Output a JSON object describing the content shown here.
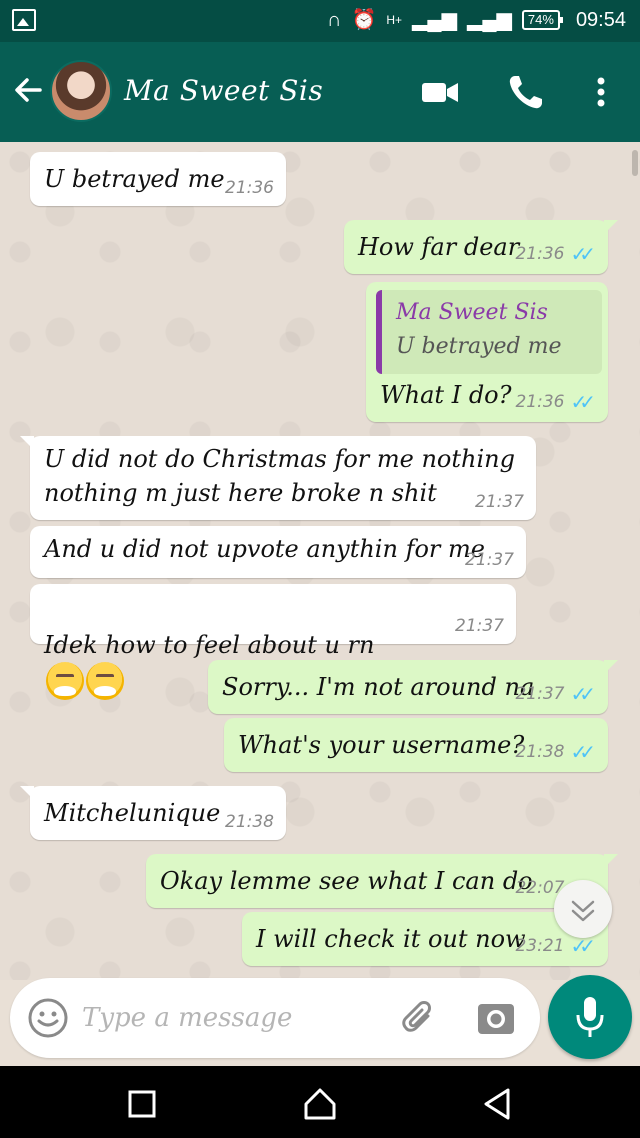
{
  "status_bar": {
    "signal_text": "H+",
    "battery": "74%",
    "time": "09:54",
    "icons": [
      "image-icon",
      "headset-icon",
      "alarm-icon",
      "signal-icon",
      "battery-icon"
    ]
  },
  "header": {
    "contact_name": "Ma Sweet Sis",
    "icons": [
      "back-arrow-icon",
      "video-call-icon",
      "phone-icon",
      "more-vert-icon"
    ]
  },
  "messages": [
    {
      "dir": "in",
      "text": "U betrayed me",
      "time": "21:36"
    },
    {
      "dir": "out",
      "text": "How far dear",
      "time": "21:36",
      "read": true
    },
    {
      "dir": "out",
      "reply_to": {
        "author": "Ma Sweet Sis",
        "text": "U betrayed me"
      },
      "text": "What I do?",
      "time": "21:36",
      "read": true
    },
    {
      "dir": "in",
      "text": "U did not do Christmas for me nothing\nnothing m just here broke n shit",
      "time": "21:37"
    },
    {
      "dir": "in",
      "text": "And u did not upvote anythin for me",
      "time": "21:37"
    },
    {
      "dir": "in",
      "text": "Idek how to feel about u rn",
      "emoji": [
        "steam-from-nose-emoji",
        "steam-from-nose-emoji"
      ],
      "time": "21:37"
    },
    {
      "dir": "out",
      "text": "Sorry... I'm not around na",
      "time": "21:37",
      "read": true
    },
    {
      "dir": "out",
      "text": "What's your username?",
      "time": "21:38",
      "read": true
    },
    {
      "dir": "in",
      "text": "Mitchelunique",
      "time": "21:38"
    },
    {
      "dir": "out",
      "text": "Okay lemme see what I can do",
      "time": "22:07",
      "read": true
    },
    {
      "dir": "out",
      "text": "I will check it out now",
      "time": "23:21",
      "read": true
    }
  ],
  "composer": {
    "placeholder": "Type a message",
    "icons": [
      "emoji-icon",
      "attach-icon",
      "camera-icon",
      "mic-icon"
    ]
  },
  "colors": {
    "header": "#075e54",
    "status_bar": "#054d44",
    "outgoing_bubble": "#dcf8c6",
    "incoming_bubble": "#ffffff",
    "read_ticks": "#4fc3f7",
    "mic_button": "#00897b"
  },
  "nav_bar": {
    "icons": [
      "recent-apps-icon",
      "home-icon",
      "back-icon"
    ]
  }
}
